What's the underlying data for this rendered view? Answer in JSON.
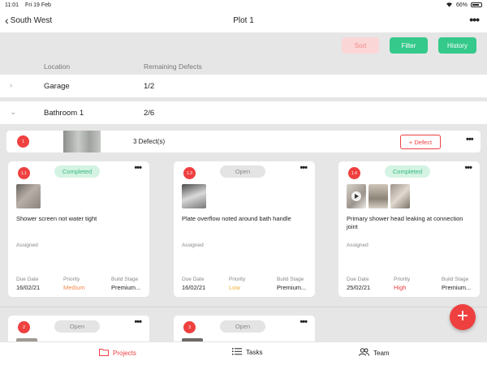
{
  "statusbar": {
    "time": "11:01",
    "date": "Fri 19 Feb",
    "battery": "66%"
  },
  "nav": {
    "back_label": "South West",
    "title": "Plot 1",
    "more": "•••"
  },
  "toolbar": {
    "sort": "Sort",
    "filter": "Filter",
    "history": "History"
  },
  "columns": {
    "location": "Location",
    "remaining": "Remaining Defects"
  },
  "locations": [
    {
      "name": "Garage",
      "count": "1/2",
      "expanded": false
    },
    {
      "name": "Bathroom 1",
      "count": "2/6",
      "expanded": true
    }
  ],
  "defect_group": {
    "badge": "1",
    "count_label": "3 Defect(s)",
    "add_label": "+ Defect",
    "more": "•••"
  },
  "labels": {
    "due_date": "Due Date",
    "priority": "Priority",
    "build_stage": "Build Stage",
    "assigned": "Assigned"
  },
  "cards": [
    {
      "badge": "1.1",
      "status": "Completed",
      "description": "Shower screen not water tight",
      "due_date": "16/02/21",
      "priority": "Medium",
      "build_stage": "Premium..."
    },
    {
      "badge": "1.3",
      "status": "Open",
      "description": "Plate overflow noted around bath handle",
      "due_date": "16/02/21",
      "priority": "Low",
      "build_stage": "Premium..."
    },
    {
      "badge": "1.4",
      "status": "Completed",
      "description": "Primary shower head leaking at connection joint",
      "due_date": "25/02/21",
      "priority": "High",
      "build_stage": "Premium..."
    }
  ],
  "next_cards": [
    {
      "badge": "2",
      "status": "Open"
    },
    {
      "badge": "3",
      "status": "Open"
    }
  ],
  "fab": "+",
  "tabs": {
    "projects": "Projects",
    "tasks": "Tasks",
    "team": "Team"
  },
  "colors": {
    "accent": "#ef4040",
    "green": "#35c98b",
    "sort_bg": "#fbd6d6"
  }
}
